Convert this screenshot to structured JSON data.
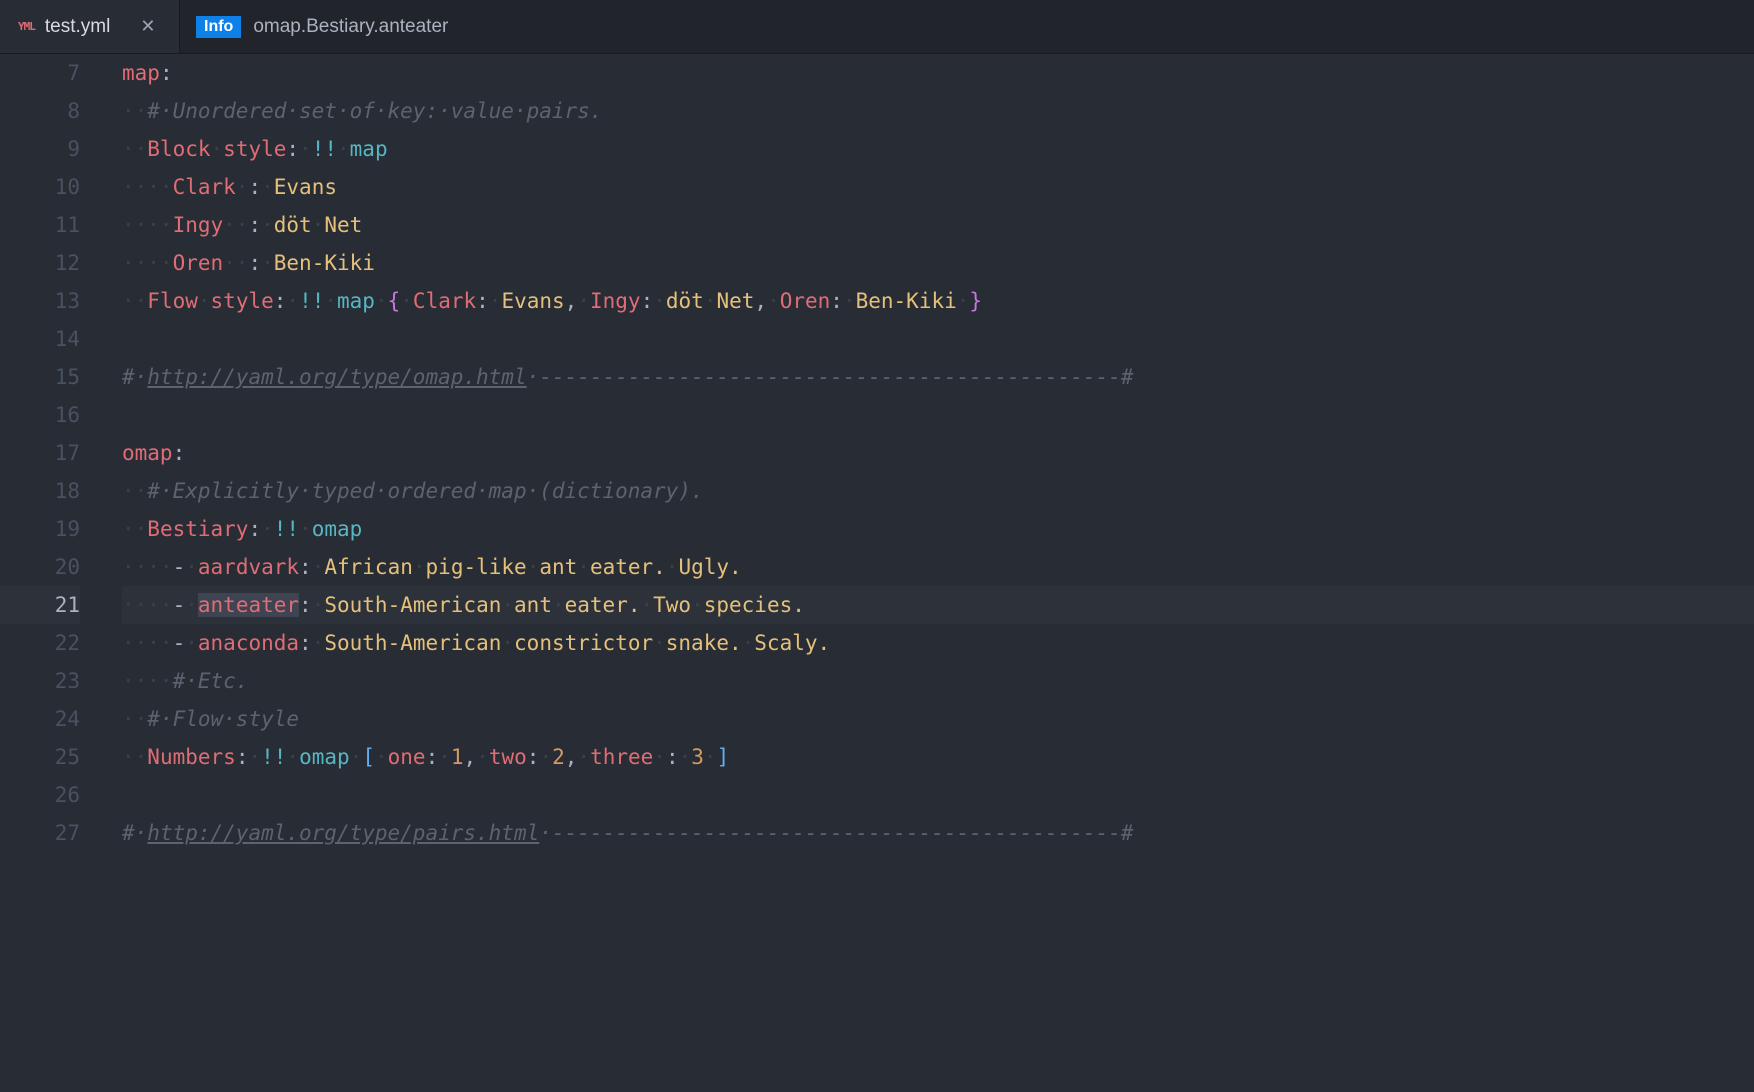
{
  "tabs": {
    "active_icon": "YML",
    "active_label": "test.yml"
  },
  "breadcrumb": {
    "badge": "Info",
    "path": "omap.Bestiary.anteater"
  },
  "editor": {
    "first_line": 7,
    "active_line": 21,
    "lines": [
      [
        {
          "t": "key",
          "v": "map"
        },
        {
          "t": "op",
          "v": ":"
        }
      ],
      [
        {
          "t": "ws",
          "v": "··"
        },
        {
          "t": "cm",
          "v": "#·Unordered·set·of·key:·value·pairs."
        }
      ],
      [
        {
          "t": "ws",
          "v": "··"
        },
        {
          "t": "key",
          "v": "Block"
        },
        {
          "t": "ws",
          "v": "·"
        },
        {
          "t": "key",
          "v": "style"
        },
        {
          "t": "op",
          "v": ":"
        },
        {
          "t": "ws",
          "v": "·"
        },
        {
          "t": "tag",
          "v": "!!"
        },
        {
          "t": "ws",
          "v": "·"
        },
        {
          "t": "tag",
          "v": "map"
        }
      ],
      [
        {
          "t": "ws",
          "v": "····"
        },
        {
          "t": "key",
          "v": "Clark"
        },
        {
          "t": "ws",
          "v": "·"
        },
        {
          "t": "op",
          "v": ":"
        },
        {
          "t": "ws",
          "v": "·"
        },
        {
          "t": "str",
          "v": "Evans"
        }
      ],
      [
        {
          "t": "ws",
          "v": "····"
        },
        {
          "t": "key",
          "v": "Ingy"
        },
        {
          "t": "ws",
          "v": "··"
        },
        {
          "t": "op",
          "v": ":"
        },
        {
          "t": "ws",
          "v": "·"
        },
        {
          "t": "str",
          "v": "döt"
        },
        {
          "t": "ws",
          "v": "·"
        },
        {
          "t": "str",
          "v": "Net"
        }
      ],
      [
        {
          "t": "ws",
          "v": "····"
        },
        {
          "t": "key",
          "v": "Oren"
        },
        {
          "t": "ws",
          "v": "··"
        },
        {
          "t": "op",
          "v": ":"
        },
        {
          "t": "ws",
          "v": "·"
        },
        {
          "t": "str",
          "v": "Ben-Kiki"
        }
      ],
      [
        {
          "t": "ws",
          "v": "··"
        },
        {
          "t": "key",
          "v": "Flow"
        },
        {
          "t": "ws",
          "v": "·"
        },
        {
          "t": "key",
          "v": "style"
        },
        {
          "t": "op",
          "v": ":"
        },
        {
          "t": "ws",
          "v": "·"
        },
        {
          "t": "tag",
          "v": "!!"
        },
        {
          "t": "ws",
          "v": "·"
        },
        {
          "t": "tag",
          "v": "map"
        },
        {
          "t": "ws",
          "v": "·"
        },
        {
          "t": "brace",
          "v": "{"
        },
        {
          "t": "ws",
          "v": "·"
        },
        {
          "t": "key",
          "v": "Clark"
        },
        {
          "t": "op",
          "v": ":"
        },
        {
          "t": "ws",
          "v": "·"
        },
        {
          "t": "str",
          "v": "Evans"
        },
        {
          "t": "op",
          "v": ","
        },
        {
          "t": "ws",
          "v": "·"
        },
        {
          "t": "key",
          "v": "Ingy"
        },
        {
          "t": "op",
          "v": ":"
        },
        {
          "t": "ws",
          "v": "·"
        },
        {
          "t": "str",
          "v": "döt"
        },
        {
          "t": "ws",
          "v": "·"
        },
        {
          "t": "str",
          "v": "Net"
        },
        {
          "t": "op",
          "v": ","
        },
        {
          "t": "ws",
          "v": "·"
        },
        {
          "t": "key",
          "v": "Oren"
        },
        {
          "t": "op",
          "v": ":"
        },
        {
          "t": "ws",
          "v": "·"
        },
        {
          "t": "str",
          "v": "Ben-Kiki"
        },
        {
          "t": "ws",
          "v": "·"
        },
        {
          "t": "brace",
          "v": "}"
        }
      ],
      [],
      [
        {
          "t": "cm",
          "v": "#·"
        },
        {
          "t": "cmlink",
          "v": "http://yaml.org/type/omap.html"
        },
        {
          "t": "cm",
          "v": "·----------------------------------------------#"
        }
      ],
      [],
      [
        {
          "t": "key",
          "v": "omap"
        },
        {
          "t": "op",
          "v": ":"
        }
      ],
      [
        {
          "t": "ws",
          "v": "··"
        },
        {
          "t": "cm",
          "v": "#·Explicitly·typed·ordered·map·(dictionary)."
        }
      ],
      [
        {
          "t": "ws",
          "v": "··"
        },
        {
          "t": "key",
          "v": "Bestiary"
        },
        {
          "t": "op",
          "v": ":"
        },
        {
          "t": "ws",
          "v": "·"
        },
        {
          "t": "tag",
          "v": "!!"
        },
        {
          "t": "ws",
          "v": "·"
        },
        {
          "t": "tag",
          "v": "omap"
        }
      ],
      [
        {
          "t": "ws",
          "v": "····"
        },
        {
          "t": "op",
          "v": "-"
        },
        {
          "t": "ws",
          "v": "·"
        },
        {
          "t": "key",
          "v": "aardvark"
        },
        {
          "t": "op",
          "v": ":"
        },
        {
          "t": "ws",
          "v": "·"
        },
        {
          "t": "str",
          "v": "African"
        },
        {
          "t": "ws",
          "v": "·"
        },
        {
          "t": "str",
          "v": "pig-like"
        },
        {
          "t": "ws",
          "v": "·"
        },
        {
          "t": "str",
          "v": "ant"
        },
        {
          "t": "ws",
          "v": "·"
        },
        {
          "t": "str",
          "v": "eater."
        },
        {
          "t": "ws",
          "v": "·"
        },
        {
          "t": "str",
          "v": "Ugly."
        }
      ],
      [
        {
          "t": "ws",
          "v": "····"
        },
        {
          "t": "op",
          "v": "-"
        },
        {
          "t": "ws",
          "v": "·"
        },
        {
          "t": "keysel",
          "v": "anteater"
        },
        {
          "t": "op",
          "v": ":"
        },
        {
          "t": "ws",
          "v": "·"
        },
        {
          "t": "str",
          "v": "South-American"
        },
        {
          "t": "ws",
          "v": "·"
        },
        {
          "t": "str",
          "v": "ant"
        },
        {
          "t": "ws",
          "v": "·"
        },
        {
          "t": "str",
          "v": "eater."
        },
        {
          "t": "ws",
          "v": "·"
        },
        {
          "t": "str",
          "v": "Two"
        },
        {
          "t": "ws",
          "v": "·"
        },
        {
          "t": "str",
          "v": "species."
        }
      ],
      [
        {
          "t": "ws",
          "v": "····"
        },
        {
          "t": "op",
          "v": "-"
        },
        {
          "t": "ws",
          "v": "·"
        },
        {
          "t": "key",
          "v": "anaconda"
        },
        {
          "t": "op",
          "v": ":"
        },
        {
          "t": "ws",
          "v": "·"
        },
        {
          "t": "str",
          "v": "South-American"
        },
        {
          "t": "ws",
          "v": "·"
        },
        {
          "t": "str",
          "v": "constrictor"
        },
        {
          "t": "ws",
          "v": "·"
        },
        {
          "t": "str",
          "v": "snake."
        },
        {
          "t": "ws",
          "v": "·"
        },
        {
          "t": "str",
          "v": "Scaly."
        }
      ],
      [
        {
          "t": "ws",
          "v": "····"
        },
        {
          "t": "cm",
          "v": "#·Etc."
        }
      ],
      [
        {
          "t": "ws",
          "v": "··"
        },
        {
          "t": "cm",
          "v": "#·Flow·style"
        }
      ],
      [
        {
          "t": "ws",
          "v": "··"
        },
        {
          "t": "key",
          "v": "Numbers"
        },
        {
          "t": "op",
          "v": ":"
        },
        {
          "t": "ws",
          "v": "·"
        },
        {
          "t": "tag",
          "v": "!!"
        },
        {
          "t": "ws",
          "v": "·"
        },
        {
          "t": "tag",
          "v": "omap"
        },
        {
          "t": "ws",
          "v": "·"
        },
        {
          "t": "brack",
          "v": "["
        },
        {
          "t": "ws",
          "v": "·"
        },
        {
          "t": "key",
          "v": "one"
        },
        {
          "t": "op",
          "v": ":"
        },
        {
          "t": "ws",
          "v": "·"
        },
        {
          "t": "num",
          "v": "1"
        },
        {
          "t": "op",
          "v": ","
        },
        {
          "t": "ws",
          "v": "·"
        },
        {
          "t": "key",
          "v": "two"
        },
        {
          "t": "op",
          "v": ":"
        },
        {
          "t": "ws",
          "v": "·"
        },
        {
          "t": "num",
          "v": "2"
        },
        {
          "t": "op",
          "v": ","
        },
        {
          "t": "ws",
          "v": "·"
        },
        {
          "t": "key",
          "v": "three"
        },
        {
          "t": "ws",
          "v": "·"
        },
        {
          "t": "op",
          "v": ":"
        },
        {
          "t": "ws",
          "v": "·"
        },
        {
          "t": "num",
          "v": "3"
        },
        {
          "t": "ws",
          "v": "·"
        },
        {
          "t": "brack",
          "v": "]"
        }
      ],
      [],
      [
        {
          "t": "cm",
          "v": "#·"
        },
        {
          "t": "cmlink",
          "v": "http://yaml.org/type/pairs.html"
        },
        {
          "t": "cm",
          "v": "·---------------------------------------------#"
        }
      ]
    ]
  }
}
